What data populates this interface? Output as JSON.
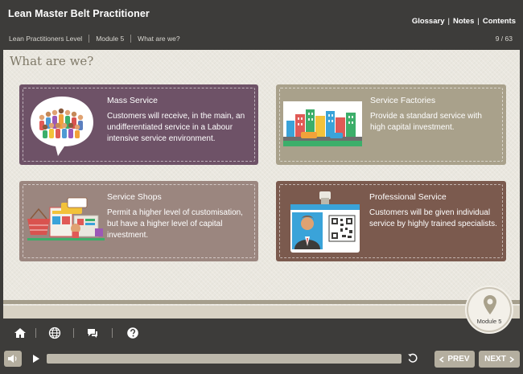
{
  "header": {
    "title": "Lean Master Belt Practitioner",
    "links": {
      "glossary": "Glossary",
      "notes": "Notes",
      "contents": "Contents",
      "separator": "|"
    },
    "breadcrumb": [
      "Lean Practitioners Level",
      "Module 5",
      "What are we?"
    ],
    "page_counter": "9 / 63"
  },
  "main": {
    "title": "What are we?",
    "cards": {
      "mass": {
        "title": "Mass Service",
        "body": "Customers will receive, in the main, an undifferentiated service in a Labour intensive service environment.",
        "color": "#6e5267"
      },
      "factories": {
        "title": "Service Factories",
        "body": "Provide a standard service with high capital investment.",
        "color": "#a9a18b"
      },
      "shops": {
        "title": "Service Shops",
        "body": "Permit a higher level of customisation, but have a higher level of capital investment.",
        "color": "#9b867f"
      },
      "professional": {
        "title": "Professional Service",
        "body": "Customers will be given individual service by highly trained specialists.",
        "color": "#7b5a4e"
      }
    },
    "module_badge": "Module 5"
  },
  "toolbar": {
    "icons": [
      "home-icon",
      "globe-icon",
      "chat-icon",
      "help-icon"
    ]
  },
  "player": {
    "prev_label": "PREV",
    "next_label": "NEXT",
    "progress": 0
  }
}
